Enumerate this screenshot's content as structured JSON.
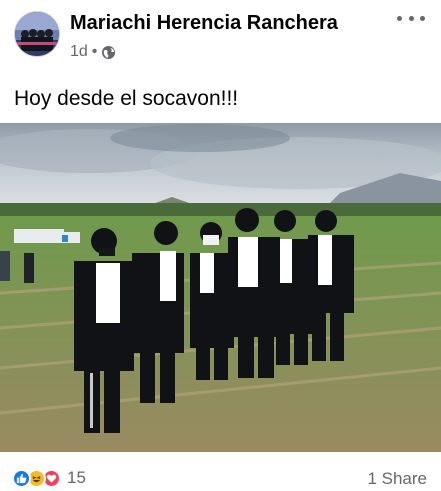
{
  "post": {
    "page_name": "Mariachi Herencia Ranchera",
    "time": "1d",
    "separator": "•",
    "privacy_icon": "globe-icon",
    "more_icon": "more-horizontal-icon",
    "text": "Hoy desde el socavon!!!"
  },
  "photo": {
    "description_icon": "group-photo"
  },
  "footer": {
    "reactions": [
      "like-icon",
      "haha-icon",
      "love-icon"
    ],
    "reaction_count": "15",
    "shares": "1 Share"
  },
  "colors": {
    "like": "#1877f2",
    "haha": "#f7b928",
    "love": "#f33e58",
    "meta_text": "#65676b"
  }
}
